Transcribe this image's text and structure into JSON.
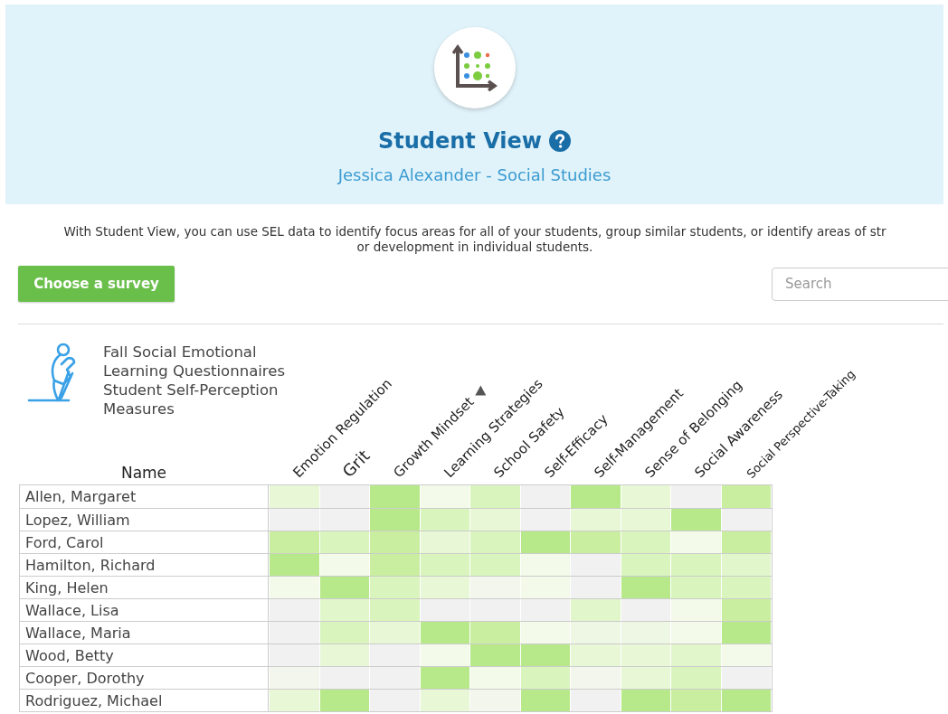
{
  "header": {
    "title": "Student View",
    "subtitle": "Jessica Alexander - Social Studies"
  },
  "description": {
    "lines": [
      "With Student View, you can use SEL data to identify focus areas for all of your students, group similar students, or identify areas of str",
      "or development in individual students."
    ]
  },
  "toolbar": {
    "button": "Choose a survey",
    "search": {
      "placeholder": "Search"
    }
  },
  "survey": {
    "title": "Fall Social Emotional Learning Questionnaires Student Self-Perception Measures"
  },
  "table": {
    "name_header": "Name",
    "columns": [
      {
        "label": "Emotion Regulation",
        "sorted": false,
        "hovered": false
      },
      {
        "label": "Grit",
        "sorted": false,
        "hovered": true
      },
      {
        "label": "Growth Mindset",
        "sorted": true,
        "hovered": false
      },
      {
        "label": "Learning Strategies",
        "sorted": false,
        "hovered": false
      },
      {
        "label": "School Safety",
        "sorted": false,
        "hovered": false
      },
      {
        "label": "Self-Efficacy",
        "sorted": false,
        "hovered": false
      },
      {
        "label": "Self-Management",
        "sorted": false,
        "hovered": false
      },
      {
        "label": "Sense of Belonging",
        "sorted": false,
        "hovered": false
      },
      {
        "label": "Social Awareness",
        "sorted": false,
        "hovered": false
      },
      {
        "label": "Social Perspective-Taking",
        "sorted": false,
        "hovered": false
      }
    ],
    "rows": [
      {
        "name": "Allen, Margaret",
        "cells": [
          {
            "color": "#e8f7d6"
          },
          {
            "color": "#f1f1f1"
          },
          {
            "color": "#b7e98a"
          },
          {
            "color": "#f3fae9"
          },
          {
            "color": "#d9f4bd"
          },
          {
            "color": "#f1f1f1"
          },
          {
            "color": "#b7e98a"
          },
          {
            "color": "#e8f7d6"
          },
          {
            "color": "#f1f1f1"
          },
          {
            "color": "#c9eea0"
          }
        ]
      },
      {
        "name": "Lopez, William",
        "cells": [
          {
            "color": "#f1f1f1"
          },
          {
            "color": "#f1f1f1"
          },
          {
            "color": "#b7e98a"
          },
          {
            "color": "#d9f4bd"
          },
          {
            "color": "#e8f7d6"
          },
          {
            "color": "#f1f1f1"
          },
          {
            "color": "#e8f7d6"
          },
          {
            "color": "#e8f7d6"
          },
          {
            "color": "#b7e98a"
          },
          {
            "color": "#f1f1f1"
          }
        ]
      },
      {
        "name": "Ford, Carol",
        "cells": [
          {
            "color": "#c9eea0"
          },
          {
            "color": "#d9f4bd"
          },
          {
            "color": "#c9eea0"
          },
          {
            "color": "#e8f7d6"
          },
          {
            "color": "#d9f4bd"
          },
          {
            "color": "#b7e98a"
          },
          {
            "color": "#c9eea0"
          },
          {
            "color": "#d9f4bd"
          },
          {
            "color": "#f3fae9"
          },
          {
            "color": "#c9eea0"
          }
        ]
      },
      {
        "name": "Hamilton, Richard",
        "cells": [
          {
            "color": "#b7e98a"
          },
          {
            "color": "#f3fae9"
          },
          {
            "color": "#c9eea0"
          },
          {
            "color": "#d9f4bd"
          },
          {
            "color": "#d9f4bd"
          },
          {
            "color": "#f3fae9"
          },
          {
            "color": "#f1f1f1"
          },
          {
            "color": "#d9f4bd"
          },
          {
            "color": "#d9f4bd"
          },
          {
            "color": "#e2f6cb"
          }
        ]
      },
      {
        "name": "King, Helen",
        "cells": [
          {
            "color": "#f3fae9"
          },
          {
            "color": "#b7e98a"
          },
          {
            "color": "#d9f4bd"
          },
          {
            "color": "#e8f7d6"
          },
          {
            "color": "#f3f6ec"
          },
          {
            "color": "#f3fae9"
          },
          {
            "color": "#f1f1f1"
          },
          {
            "color": "#b7e98a"
          },
          {
            "color": "#d9f4bd"
          },
          {
            "color": "#d9f4bd"
          }
        ]
      },
      {
        "name": "Wallace, Lisa",
        "cells": [
          {
            "color": "#f1f1f1"
          },
          {
            "color": "#e2f6cb"
          },
          {
            "color": "#d9f4bd"
          },
          {
            "color": "#f1f1f1"
          },
          {
            "color": "#f1f1f1"
          },
          {
            "color": "#f1f1f1"
          },
          {
            "color": "#e2f6cb"
          },
          {
            "color": "#f1f1f1"
          },
          {
            "color": "#f3fae9"
          },
          {
            "color": "#c9eea0"
          }
        ]
      },
      {
        "name": "Wallace, Maria",
        "cells": [
          {
            "color": "#f1f1f1"
          },
          {
            "color": "#d9f4bd"
          },
          {
            "color": "#e8f7d6"
          },
          {
            "color": "#b7e98a"
          },
          {
            "color": "#c9eea0"
          },
          {
            "color": "#f3fae9"
          },
          {
            "color": "#eef6e4"
          },
          {
            "color": "#eef6e4"
          },
          {
            "color": "#f3fae9"
          },
          {
            "color": "#b7e98a"
          }
        ]
      },
      {
        "name": "Wood, Betty",
        "cells": [
          {
            "color": "#f1f1f1"
          },
          {
            "color": "#e8f7d6"
          },
          {
            "color": "#f1f1f1"
          },
          {
            "color": "#f3fae9"
          },
          {
            "color": "#b7e98a"
          },
          {
            "color": "#b7e98a"
          },
          {
            "color": "#e8f7d6"
          },
          {
            "color": "#e8f7d6"
          },
          {
            "color": "#e2f6cb"
          },
          {
            "color": "#f3fae9"
          }
        ]
      },
      {
        "name": "Cooper, Dorothy",
        "cells": [
          {
            "color": "#f3f6ec"
          },
          {
            "color": "#f1f1f1"
          },
          {
            "color": "#f1f1f1"
          },
          {
            "color": "#b7e98a"
          },
          {
            "color": "#f3fae9"
          },
          {
            "color": "#d9f4bd"
          },
          {
            "color": "#f3f6ec"
          },
          {
            "color": "#e8f7d6"
          },
          {
            "color": "#d9f4bd"
          },
          {
            "color": "#f1f1f1"
          }
        ]
      },
      {
        "name": "Rodriguez, Michael",
        "cells": [
          {
            "color": "#e8f7d6"
          },
          {
            "color": "#b7e98a"
          },
          {
            "color": "#f1f1f1"
          },
          {
            "color": "#e8f7d6"
          },
          {
            "color": "#f3f6ec"
          },
          {
            "color": "#b7e98a"
          },
          {
            "color": "#f1f1f1"
          },
          {
            "color": "#b7e98a"
          },
          {
            "color": "#c9eea0"
          },
          {
            "color": "#b7e98a"
          }
        ]
      }
    ]
  }
}
